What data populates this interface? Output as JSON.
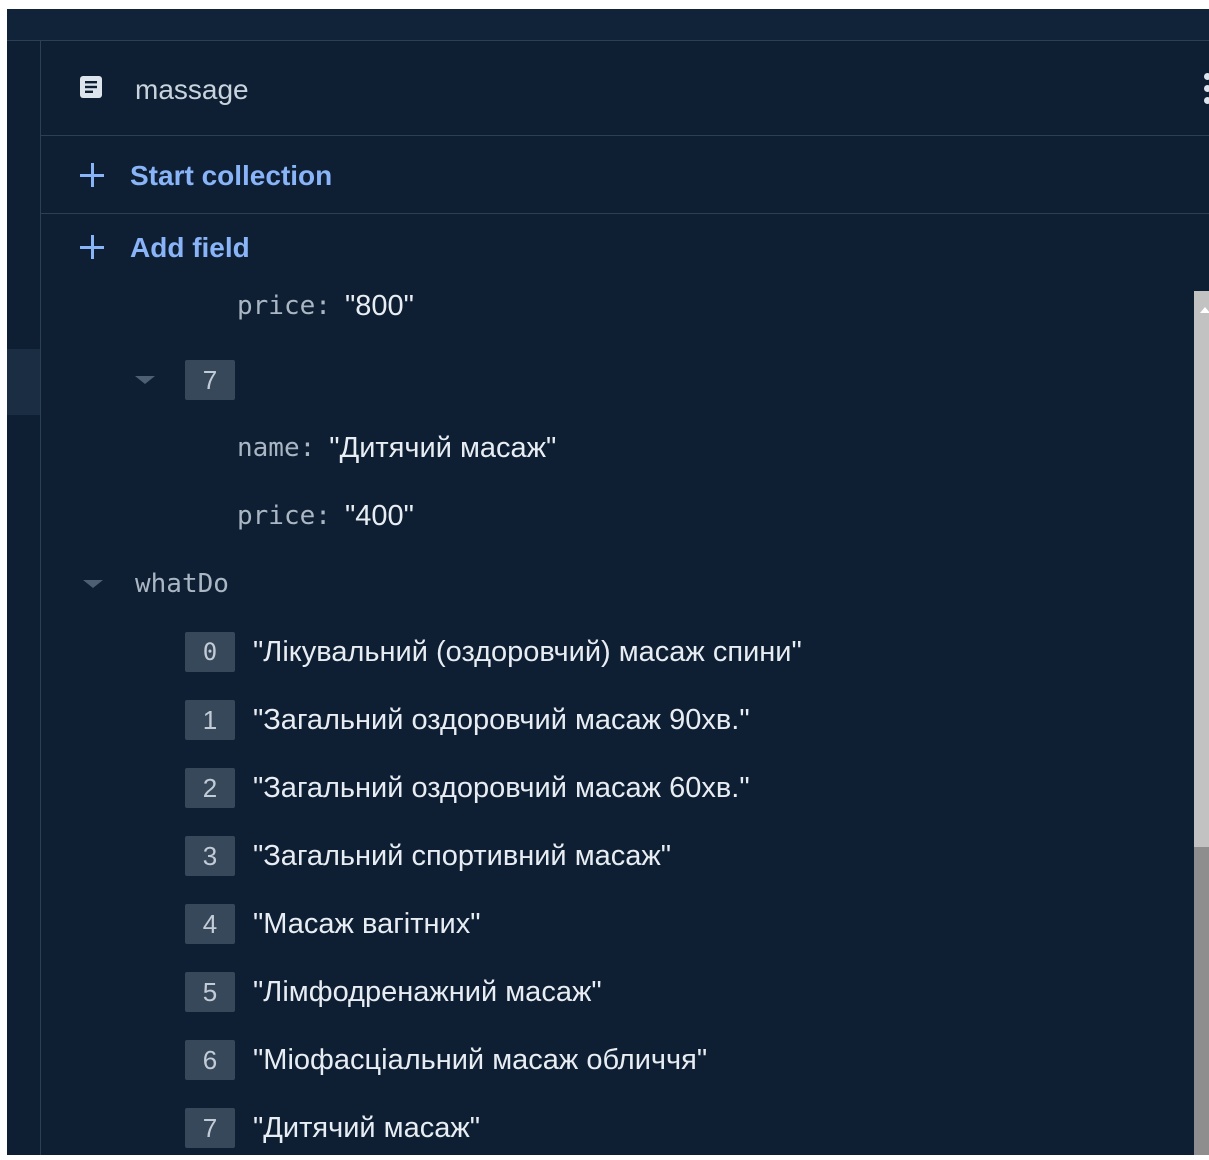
{
  "document": {
    "title": "massage",
    "icon": "document-icon",
    "menu_icon": "more-vert-icon"
  },
  "actions": {
    "start_collection": "Start collection",
    "add_field": "Add field"
  },
  "fields": {
    "prev_price_key": "price",
    "prev_price_value": "\"800\"",
    "item7": {
      "index": "7",
      "name_key": "name",
      "name_value": "\"Дитячий масаж\"",
      "price_key": "price",
      "price_value": "\"400\""
    },
    "whatDo": {
      "key": "whatDo",
      "items": [
        {
          "index": "0",
          "value": "\"Лікувальний (оздоровчий) масаж спини\""
        },
        {
          "index": "1",
          "value": "\"Загальний оздоровчий масаж 90хв.\""
        },
        {
          "index": "2",
          "value": "\"Загальний оздоровчий масаж 60хв.\""
        },
        {
          "index": "3",
          "value": "\"Загальний спортивний масаж\""
        },
        {
          "index": "4",
          "value": "\"Масаж вагітних\""
        },
        {
          "index": "5",
          "value": "\"Лімфодренажний масаж\""
        },
        {
          "index": "6",
          "value": "\"Міофасціальний масаж обличчя\""
        },
        {
          "index": "7",
          "value": "\"Дитячий масаж\""
        }
      ]
    }
  },
  "colors": {
    "background": "#0e1f33",
    "accent": "#8ab4f8",
    "divider": "#2b3f55",
    "index_badge": "#37485b"
  }
}
